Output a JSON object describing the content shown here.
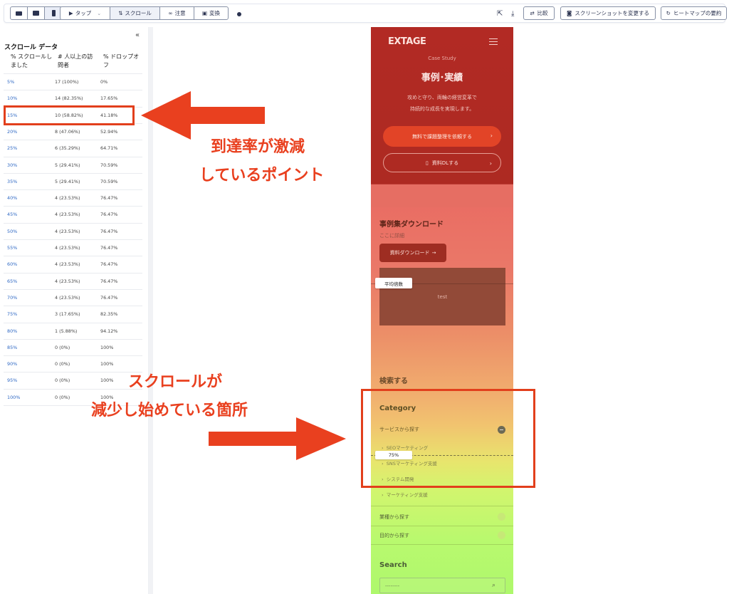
{
  "toolbar": {
    "tap": "タップ",
    "scroll": "スクロール",
    "attention": "注意",
    "conversion": "変換",
    "compare": "比較",
    "change_screenshot": "スクリーンショットを変更する",
    "heatmap_summary": "ヒートマップの要約"
  },
  "panel": {
    "title": "スクロール データ",
    "col_pct": "% スクロールしました",
    "col_visitors": "# 人以上の訪問者",
    "col_dropoff": "% ドロップオフ",
    "rows": [
      {
        "pct": "5%",
        "visitors": "17 (100%)",
        "dropoff": "0%"
      },
      {
        "pct": "10%",
        "visitors": "14 (82.35%)",
        "dropoff": "17.65%"
      },
      {
        "pct": "15%",
        "visitors": "10 (58.82%)",
        "dropoff": "41.18%"
      },
      {
        "pct": "20%",
        "visitors": "8 (47.06%)",
        "dropoff": "52.94%"
      },
      {
        "pct": "25%",
        "visitors": "6 (35.29%)",
        "dropoff": "64.71%"
      },
      {
        "pct": "30%",
        "visitors": "5 (29.41%)",
        "dropoff": "70.59%"
      },
      {
        "pct": "35%",
        "visitors": "5 (29.41%)",
        "dropoff": "70.59%"
      },
      {
        "pct": "40%",
        "visitors": "4 (23.53%)",
        "dropoff": "76.47%"
      },
      {
        "pct": "45%",
        "visitors": "4 (23.53%)",
        "dropoff": "76.47%"
      },
      {
        "pct": "50%",
        "visitors": "4 (23.53%)",
        "dropoff": "76.47%"
      },
      {
        "pct": "55%",
        "visitors": "4 (23.53%)",
        "dropoff": "76.47%"
      },
      {
        "pct": "60%",
        "visitors": "4 (23.53%)",
        "dropoff": "76.47%"
      },
      {
        "pct": "65%",
        "visitors": "4 (23.53%)",
        "dropoff": "76.47%"
      },
      {
        "pct": "70%",
        "visitors": "4 (23.53%)",
        "dropoff": "76.47%"
      },
      {
        "pct": "75%",
        "visitors": "3 (17.65%)",
        "dropoff": "82.35%"
      },
      {
        "pct": "80%",
        "visitors": "1 (5.88%)",
        "dropoff": "94.12%"
      },
      {
        "pct": "85%",
        "visitors": "0 (0%)",
        "dropoff": "100%"
      },
      {
        "pct": "90%",
        "visitors": "0 (0%)",
        "dropoff": "100%"
      },
      {
        "pct": "95%",
        "visitors": "0 (0%)",
        "dropoff": "100%"
      },
      {
        "pct": "100%",
        "visitors": "0 (0%)",
        "dropoff": "100%"
      }
    ]
  },
  "preview": {
    "logo": "EXTAGE",
    "case_study": "Case Study",
    "heading": "事例･実績",
    "lead_1": "攻めと守り、両輪の経営変革で",
    "lead_2": "持続的な成長を実現します。",
    "cta_primary": "無料で課題整理を依頼する",
    "cta_secondary": "資料DLする",
    "download_title": "事例集ダウンロード",
    "download_sub": "ここに詳細",
    "download_btn": "資料ダウンロード",
    "test_label": "test",
    "avg_fold": "平均倍数",
    "search_heading": "検索する",
    "category_heading": "Category",
    "cat_service": "サービスから探す",
    "sub_items": [
      "SEOマーケティング",
      "SNSマーケティング支援",
      "システム開発",
      "マーケティング支援"
    ],
    "marker_75": "75%",
    "cat_industry": "業種から探す",
    "cat_purpose": "目的から探す",
    "search_label": "Search",
    "search_placeholder": "--------"
  },
  "annotations": {
    "drop_line1": "到達率が激減",
    "drop_line2": "しているポイント",
    "scroll_line1": "スクロールが",
    "scroll_line2": "減少し始めている箇所"
  },
  "colors": {
    "annotation": "#e9401f",
    "link": "#2e68c4"
  }
}
